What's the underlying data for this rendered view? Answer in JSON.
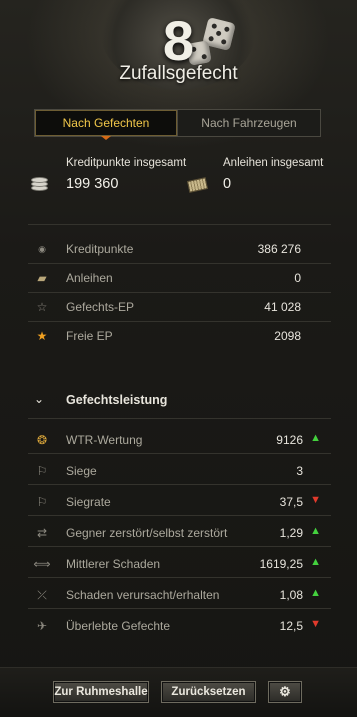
{
  "header": {
    "level": "8",
    "mode_title": "Zufallsgefecht"
  },
  "tabs": [
    {
      "label": "Nach Gefechten",
      "active": true
    },
    {
      "label": "Nach Fahrzeugen",
      "active": false
    }
  ],
  "totals": {
    "credits_label": "Kreditpunkte insgesamt",
    "credits_value": "199 360",
    "bonds_label": "Anleihen insgesamt",
    "bonds_value": "0"
  },
  "currencies": [
    {
      "icon": "credits-icon",
      "label": "Kreditpunkte",
      "value": "386 276"
    },
    {
      "icon": "bonds-icon",
      "label": "Anleihen",
      "value": "0"
    },
    {
      "icon": "star-outline-icon",
      "label": "Gefechts-EP",
      "value": "41 028"
    },
    {
      "icon": "star-gold-icon",
      "label": "Freie EP",
      "value": "2098"
    }
  ],
  "performance": {
    "title": "Gefechtsleistung",
    "rows": [
      {
        "icon": "wtr-rating-icon",
        "label": "WTR-Wertung",
        "value": "9126",
        "trend": "up"
      },
      {
        "icon": "flag-icon",
        "label": "Siege",
        "value": "3",
        "trend": ""
      },
      {
        "icon": "flag-percent-icon",
        "label": "Siegrate",
        "value": "37,5",
        "trend": "down"
      },
      {
        "icon": "destroyed-ratio-icon",
        "label": "Gegner zerstört/selbst zerstört",
        "value": "1,29",
        "trend": "up"
      },
      {
        "icon": "damage-icon",
        "label": "Mittlerer Schaden",
        "value": "1619,25",
        "trend": "up"
      },
      {
        "icon": "damage-ratio-icon",
        "label": "Schaden verursacht/erhalten",
        "value": "1,08",
        "trend": "up"
      },
      {
        "icon": "survival-icon",
        "label": "Überlebte Gefechte",
        "value": "12,5",
        "trend": "down"
      }
    ]
  },
  "footer": {
    "hall_of_fame_label": "Zur Ruhmeshalle",
    "reset_label": "Zurücksetzen"
  },
  "colors": {
    "accent": "#f2c84a",
    "trend_up": "#44d13e",
    "trend_down": "#e23a2c"
  }
}
